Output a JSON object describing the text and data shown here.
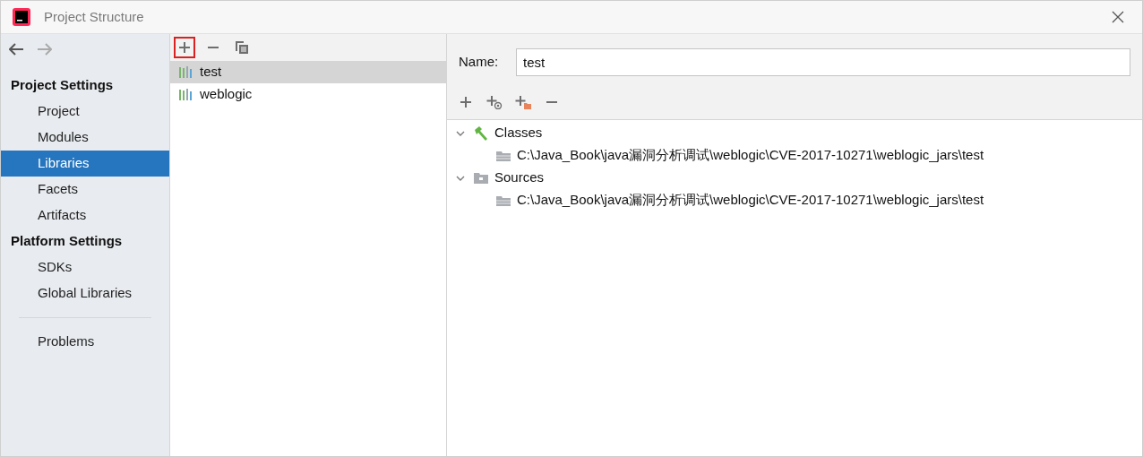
{
  "window": {
    "title": "Project Structure"
  },
  "sidebar": {
    "sections": [
      {
        "title": "Project Settings",
        "items": [
          {
            "label": "Project",
            "selected": false
          },
          {
            "label": "Modules",
            "selected": false
          },
          {
            "label": "Libraries",
            "selected": true
          },
          {
            "label": "Facets",
            "selected": false
          },
          {
            "label": "Artifacts",
            "selected": false
          }
        ]
      },
      {
        "title": "Platform Settings",
        "items": [
          {
            "label": "SDKs",
            "selected": false
          },
          {
            "label": "Global Libraries",
            "selected": false
          }
        ]
      }
    ],
    "footer_items": [
      {
        "label": "Problems",
        "selected": false
      }
    ]
  },
  "libraries": {
    "toolbar": [
      {
        "kind": "add",
        "highlighted": true
      },
      {
        "kind": "remove",
        "highlighted": false
      },
      {
        "kind": "copy",
        "highlighted": false
      }
    ],
    "items": [
      {
        "label": "test",
        "selected": true
      },
      {
        "label": "weblogic",
        "selected": false
      }
    ]
  },
  "details": {
    "name_label": "Name:",
    "name_value": "test",
    "toolbar": [
      {
        "kind": "add"
      },
      {
        "kind": "add-url"
      },
      {
        "kind": "add-folder"
      },
      {
        "kind": "remove"
      }
    ],
    "tree": [
      {
        "label": "Classes",
        "kind": "classes",
        "expanded": true,
        "children": [
          {
            "label": "C:\\Java_Book\\java漏洞分析调试\\weblogic\\CVE-2017-10271\\weblogic_jars\\test"
          }
        ]
      },
      {
        "label": "Sources",
        "kind": "sources",
        "expanded": true,
        "children": [
          {
            "label": "C:\\Java_Book\\java漏洞分析调试\\weblogic\\CVE-2017-10271\\weblogic_jars\\test"
          }
        ]
      }
    ]
  }
}
